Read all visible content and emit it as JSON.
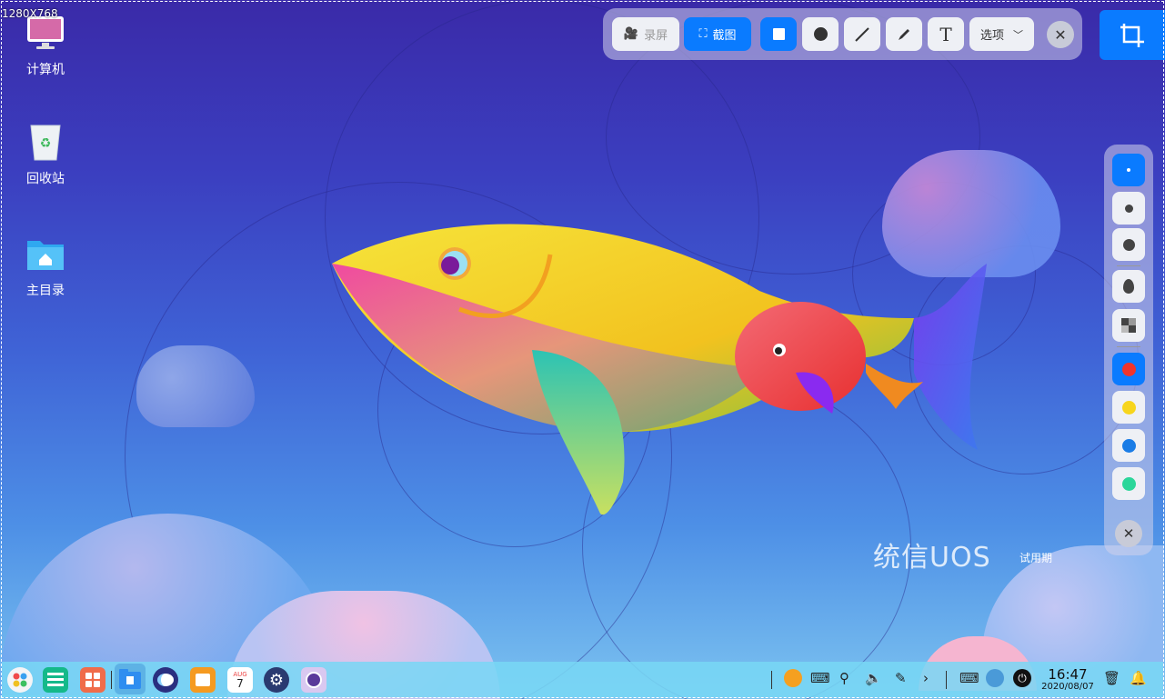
{
  "resolution_label": "1280X768",
  "desktop_icons": [
    {
      "label": "计算机",
      "icon": "computer-icon"
    },
    {
      "label": "回收站",
      "icon": "trash-icon"
    },
    {
      "label": "主目录",
      "icon": "home-folder-icon"
    }
  ],
  "toolbar": {
    "record_label": "录屏",
    "screenshot_label": "截图",
    "text_tool_glyph": "T",
    "options_label": "选项",
    "tools": [
      "rectangle-tool",
      "ellipse-tool",
      "line-tool",
      "pen-tool",
      "text-tool"
    ]
  },
  "palette": {
    "sizes": [
      "small",
      "medium",
      "large"
    ],
    "effects": [
      "blur",
      "mosaic"
    ],
    "colors": [
      "#f0342b",
      "#f7d51c",
      "#1a7ce6",
      "#2bd69a"
    ],
    "selected_color": "#f0342b"
  },
  "watermark": {
    "brand": "统信UOS",
    "sub": "试用期"
  },
  "taskbar": {
    "apps": [
      "launcher-icon",
      "multitask-icon",
      "app-store-icon",
      "file-manager-icon",
      "browser-icon",
      "store-bag-icon",
      "calendar-icon",
      "settings-icon",
      "camera-icon"
    ],
    "calendar_month": "AUG",
    "calendar_day": "7",
    "tray": [
      "input-method-icon",
      "keyboard-icon",
      "usb-icon",
      "volume-icon",
      "pen-icon",
      "chevron-right-icon",
      "keyboard-toggle-icon",
      "network-icon",
      "power-icon"
    ],
    "time": "16:47",
    "date": "2020/08/07"
  },
  "colors": {
    "accent": "#0a7bff"
  }
}
